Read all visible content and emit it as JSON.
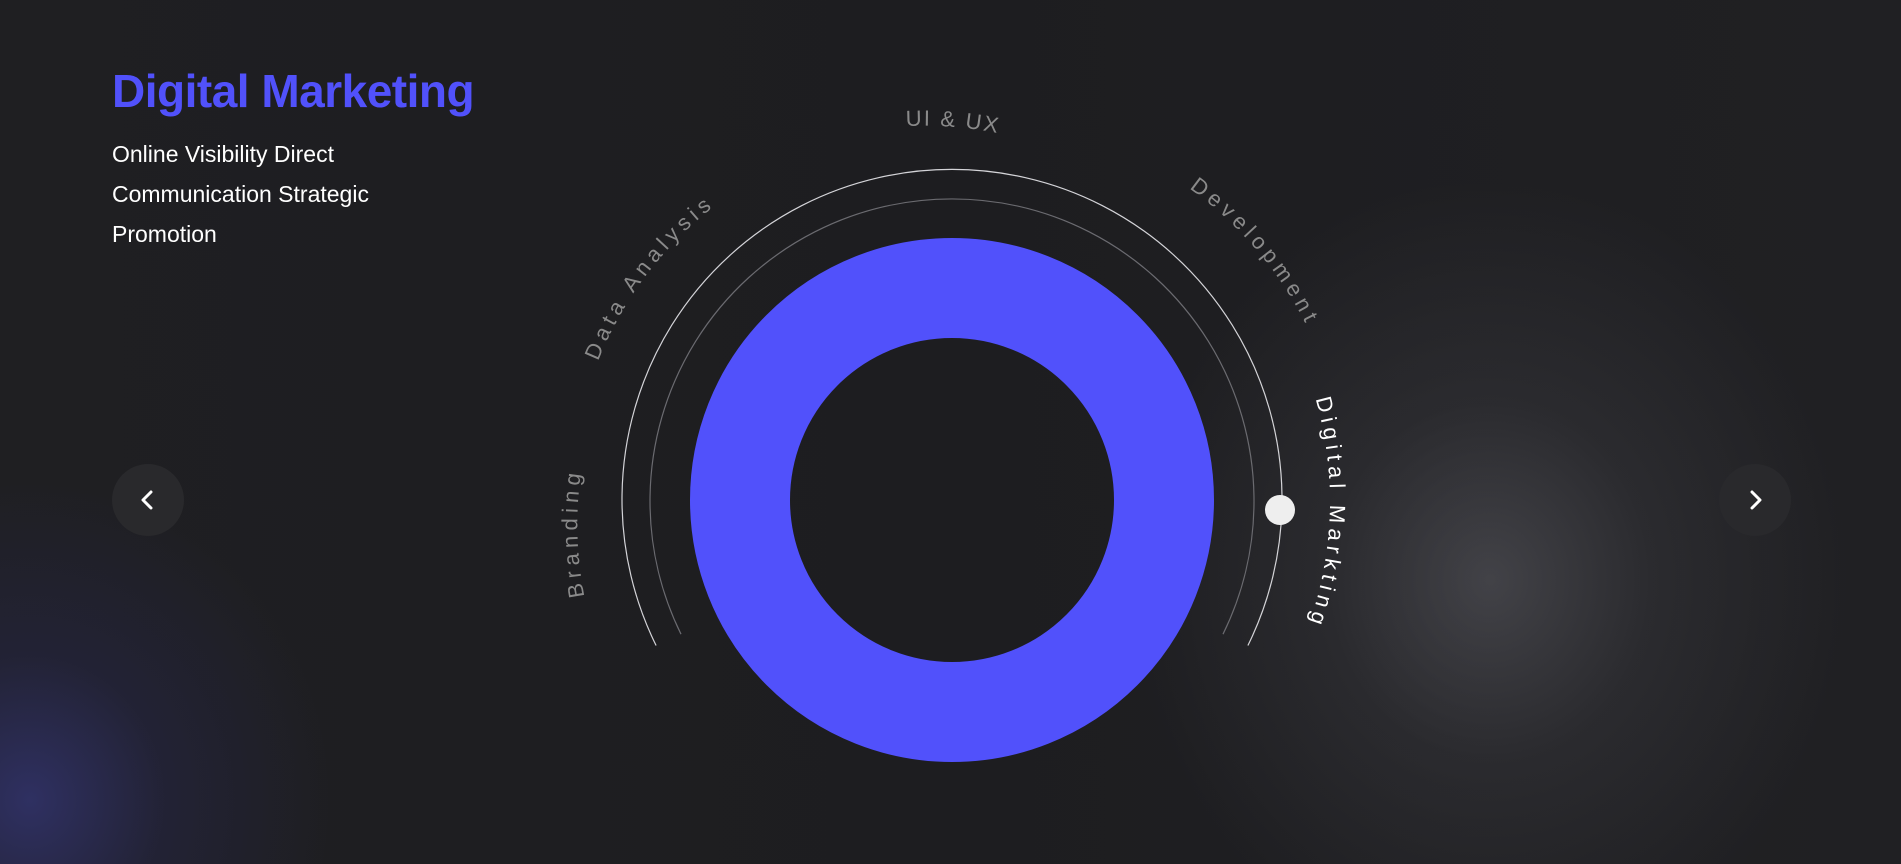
{
  "service": {
    "title": "Digital Marketing",
    "description": "Online Visibility Direct Communication Strategic Promotion"
  },
  "wheel": {
    "segments": [
      {
        "label": "Branding",
        "active": false
      },
      {
        "label": "Data Analysis",
        "active": false
      },
      {
        "label": "UI & UX",
        "active": false
      },
      {
        "label": "Development",
        "active": false
      },
      {
        "label": "Digital Markting",
        "active": true
      }
    ]
  },
  "navigation": {
    "prev_icon": "chevron-left-icon",
    "next_icon": "chevron-right-icon"
  },
  "colors": {
    "accent": "#5151fb",
    "background": "#1e1e21",
    "active_label": "#ffffff",
    "inactive_label": "#8a8a8a"
  }
}
